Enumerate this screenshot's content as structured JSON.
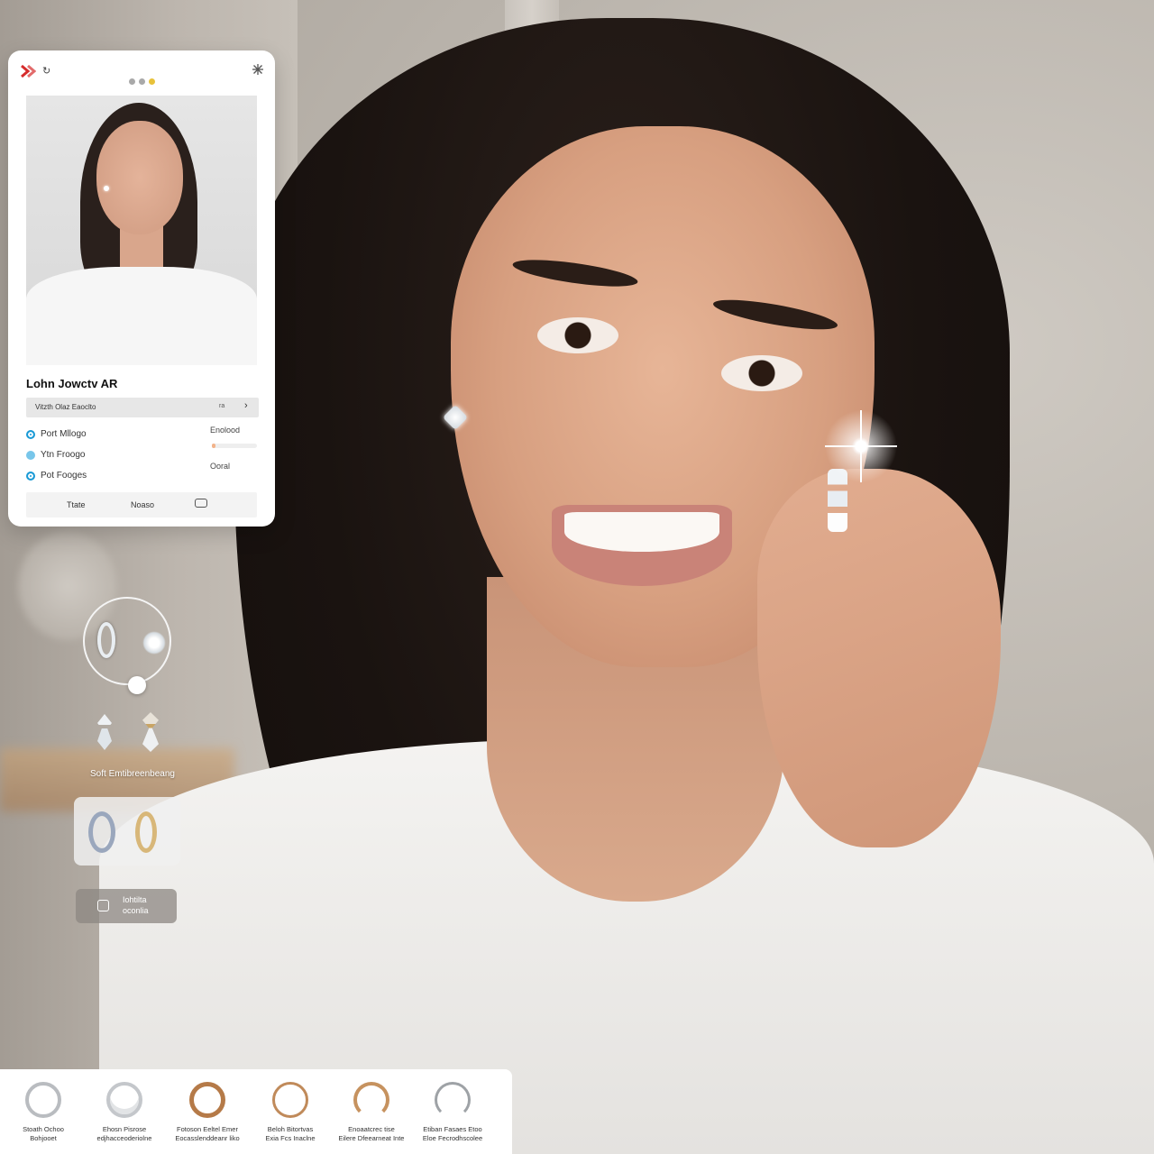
{
  "panel": {
    "title": "Lohn Jowctv AR",
    "product_selector": "Vitzth Olaz Eaoclto",
    "product_selector_mark": "ra",
    "product_selector_chevron": "›",
    "options": [
      {
        "label": "Port Mllogo",
        "state": "selected"
      },
      {
        "label": "Ytn Froogo",
        "state": "light"
      },
      {
        "label": "Pot Fooges",
        "state": "filled"
      }
    ],
    "side_value_top": "Enolood",
    "side_value_bottom": "Ooral",
    "bottom_buttons": [
      "Ttate",
      "Noaso"
    ],
    "back_icon": "↻"
  },
  "picker": {
    "caption": "Soft Emtibreenbeang"
  },
  "try_on_button": {
    "line1": "Iohtilta",
    "line2": "oconlia"
  },
  "product_strip": [
    {
      "name_line1": "Stoath Ochoo",
      "name_line2": "Bohjooet",
      "style": "t-silver"
    },
    {
      "name_line1": "Ehosn Pisrose",
      "name_line2": "edjhacceoderiolne",
      "style": "t-silver2"
    },
    {
      "name_line1": "Fotoson Eeltel Emer",
      "name_line2": "Eocasslenddeanr liko",
      "style": "t-gold"
    },
    {
      "name_line1": "Beloh Bitortvas",
      "name_line2": "Exia Fcs Inaclne",
      "style": "t-gold2"
    },
    {
      "name_line1": "Enoaatcrec tise",
      "name_line2": "Eilere Dfeearneat Inte",
      "style": "t-gold3"
    },
    {
      "name_line1": "Etiban Fasaes Etoo",
      "name_line2": "Eloe Fecrodhscolee",
      "style": "t-silver3"
    }
  ],
  "colors": {
    "accent_blue": "#1a9ad6",
    "dot_active": "#e8c23a",
    "logo_red": "#d62c2c"
  }
}
